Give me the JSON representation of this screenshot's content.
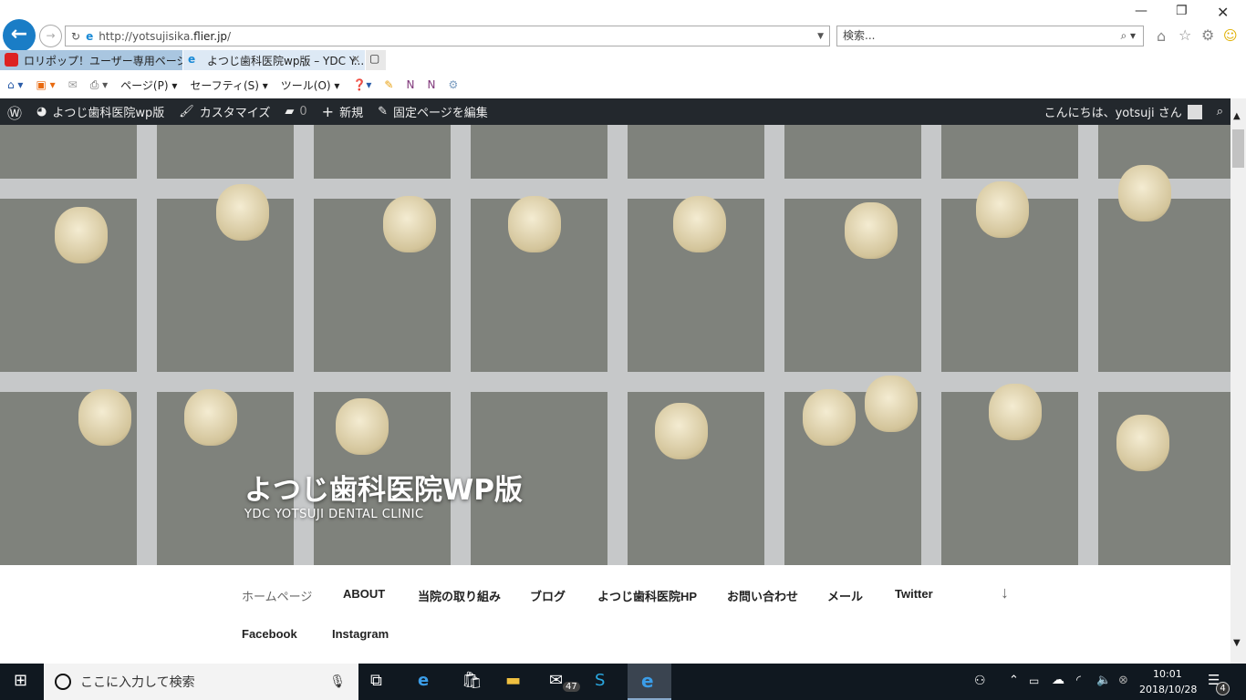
{
  "browser": {
    "url_prefix": "http://yotsujisika.",
    "url_domain": "flier.jp",
    "url_suffix": "/",
    "search_placeholder": "検索...",
    "tabs": [
      {
        "label": "ロリポップ！ユーザー専用ページ - ...",
        "active": false
      },
      {
        "label": "よつじ歯科医院wp版 – YDC Y...",
        "active": true
      }
    ],
    "commands": {
      "page": "ページ(P)",
      "safety": "セーフティ(S)",
      "tools": "ツール(O)"
    }
  },
  "wp_admin": {
    "site": "よつじ歯科医院wp版",
    "customize": "カスタマイズ",
    "comments": "0",
    "new": "新規",
    "edit": "固定ページを編集",
    "greeting": "こんにちは、yotsuji さん"
  },
  "hero": {
    "title": "よつじ歯科医院WP版",
    "subtitle": "YDC YOTSUJI DENTAL CLINIC"
  },
  "nav": [
    "ホームページ",
    "ABOUT",
    "当院の取り組み",
    "ブログ",
    "よつじ歯科医院HP",
    "お問い合わせ",
    "メール",
    "Twitter",
    "Facebook",
    "Instagram"
  ],
  "nav_scroll": "↓",
  "taskbar": {
    "search_placeholder": "ここに入力して検索",
    "mail_badge": "47",
    "time": "10:01",
    "date": "2018/10/28",
    "notifications": "4"
  }
}
